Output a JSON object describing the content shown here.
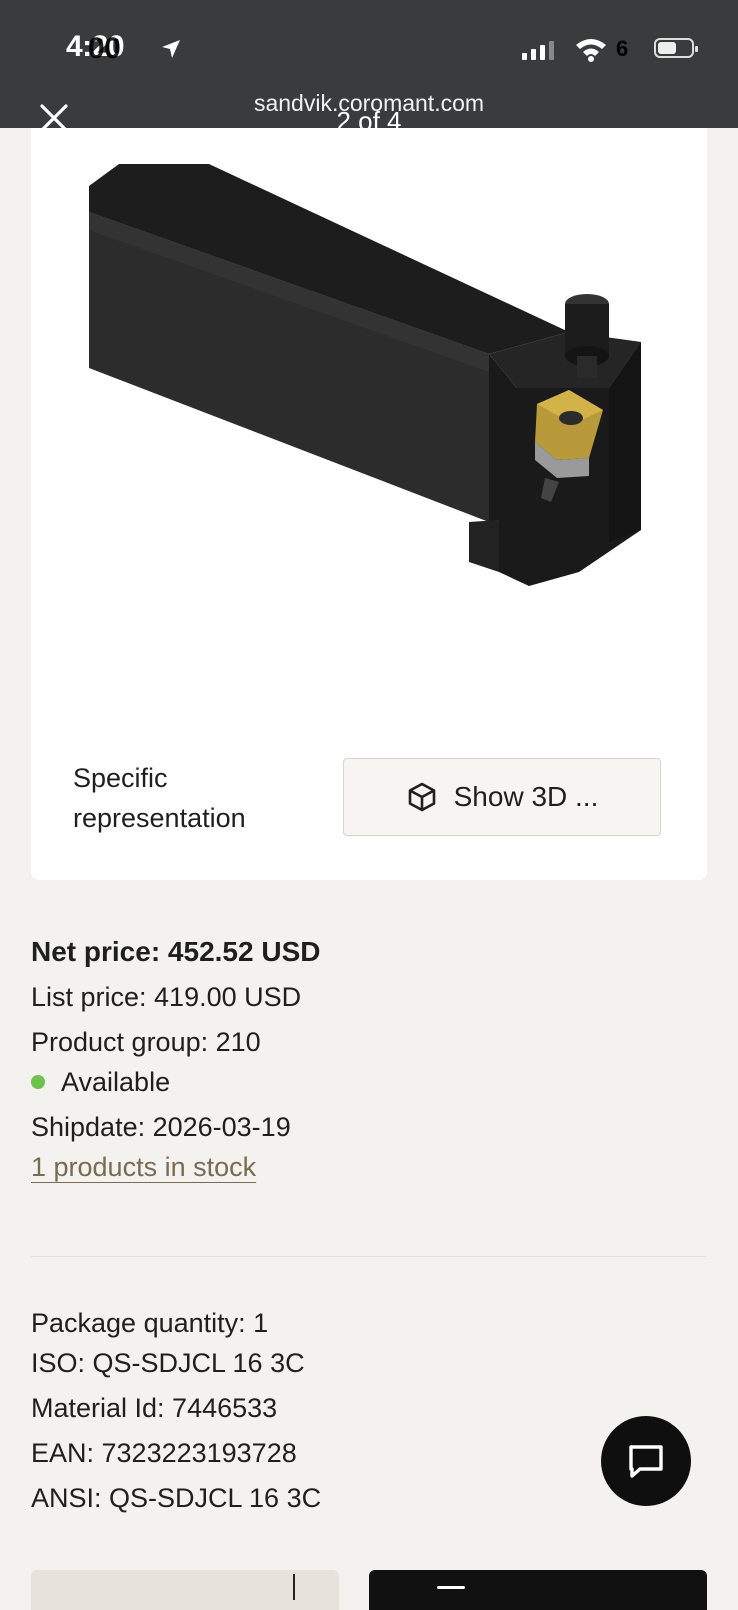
{
  "status_bar": {
    "time": "4:20",
    "time_overlay": "00",
    "vpn_badge": "6"
  },
  "browser": {
    "url": "sandvik.coromant.com",
    "pager": "2 of 4"
  },
  "product_card": {
    "representation_label": "Specific representation",
    "show_3d_label": "Show 3D ..."
  },
  "pricing": {
    "net_price": "Net price: 452.52 USD",
    "list_price": "List price: 419.00 USD",
    "product_group": "Product group: 210",
    "availability": "Available",
    "availability_color": "#6dc34a",
    "shipdate": "Shipdate: 2026-03-19",
    "stock_link": "1 products in stock"
  },
  "specs": {
    "package_quantity": "Package quantity: 1",
    "iso": "ISO: QS-SDJCL 16 3C",
    "material_id": "Material Id: 7446533",
    "ean": "EAN: 7323223193728",
    "ansi": "ANSI: QS-SDJCL 16 3C"
  },
  "icons": {
    "close": "close-icon",
    "cube": "cube-icon",
    "chat": "chat-icon"
  }
}
